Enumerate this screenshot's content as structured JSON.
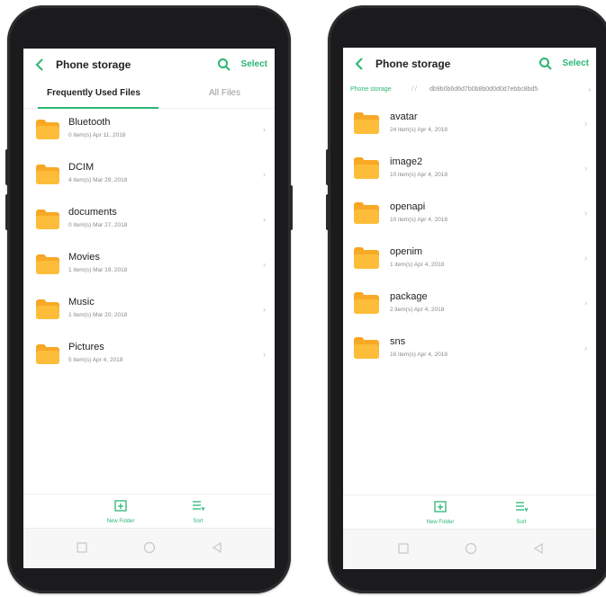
{
  "screens": [
    {
      "title": "Phone storage",
      "select_label": "Select",
      "tabs": [
        {
          "label": "Frequently Used Files"
        },
        {
          "label": "All Files"
        }
      ],
      "items": [
        {
          "name": "Bluetooth",
          "meta": "0 item(s)  Apr 11, 2018"
        },
        {
          "name": "DCIM",
          "meta": "4 item(s)  Mar 29, 2018"
        },
        {
          "name": "documents",
          "meta": "0 item(s)  Mar 27, 2018"
        },
        {
          "name": "Movies",
          "meta": "1 item(s)  Mar 19, 2018"
        },
        {
          "name": "Music",
          "meta": "1 item(s)  Mar 20, 2018"
        },
        {
          "name": "Pictures",
          "meta": "5 item(s)  Apr 4, 2018"
        }
      ],
      "toolbar": {
        "new_folder": "New Folder",
        "sort": "Sort"
      }
    },
    {
      "title": "Phone storage",
      "select_label": "Select",
      "breadcrumb": {
        "root": "Phone storage",
        "separator": "/ /",
        "path": "db9b0b6d6d7b0b8b0d0d0d7ebbc8bd5",
        "arrow": "›"
      },
      "items": [
        {
          "name": "avatar",
          "meta": "24 item(s)  Apr 4, 2018"
        },
        {
          "name": "image2",
          "meta": "10 item(s)  Apr 4, 2018"
        },
        {
          "name": "openapi",
          "meta": "10 item(s)  Apr 4, 2018"
        },
        {
          "name": "openim",
          "meta": "1 item(s)  Apr 4, 2018"
        },
        {
          "name": "package",
          "meta": "2 item(s)  Apr 4, 2018"
        },
        {
          "name": "sns",
          "meta": "16 item(s)  Apr 4, 2018"
        }
      ],
      "toolbar": {
        "new_folder": "New Folder",
        "sort": "Sort"
      }
    }
  ],
  "chevron": "›",
  "colors": {
    "accent": "#2bb673",
    "folder": "#f8a926",
    "bezel": "#1b1b1d"
  }
}
